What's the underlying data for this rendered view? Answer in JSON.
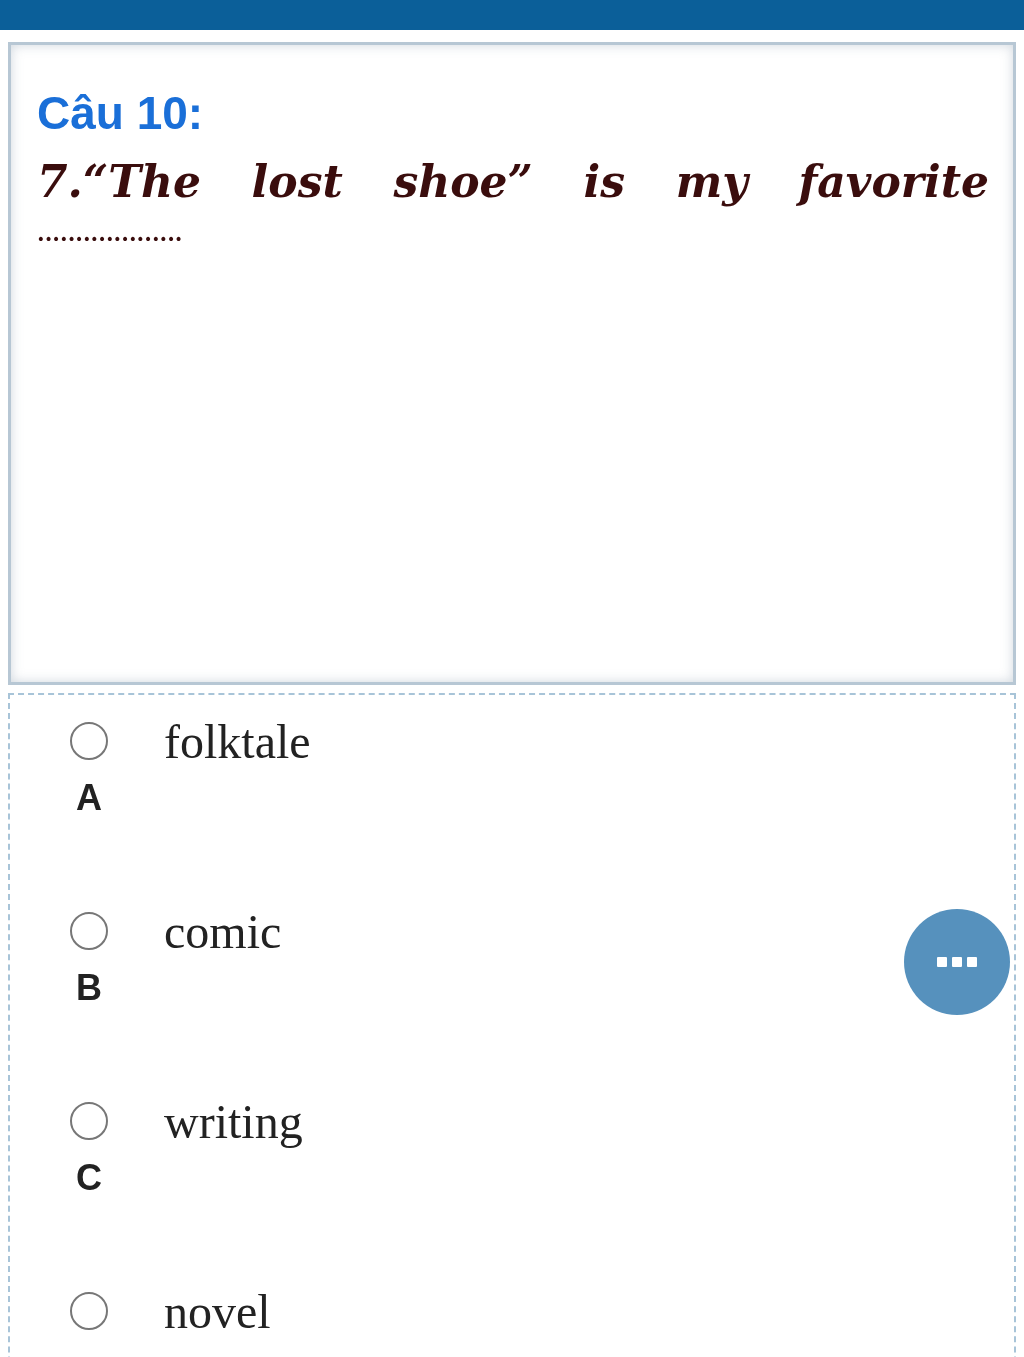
{
  "question": {
    "title": "Câu 10:",
    "text": "7.“The lost shoe” is my favorite",
    "blank": "..................."
  },
  "options": [
    {
      "text": "folktale",
      "label": "A",
      "selected": false
    },
    {
      "text": "comic",
      "label": "B",
      "selected": false
    },
    {
      "text": "writing",
      "label": "C",
      "selected": false
    },
    {
      "text": "novel",
      "selected": false
    }
  ],
  "more_button": {
    "kind": "dots"
  }
}
